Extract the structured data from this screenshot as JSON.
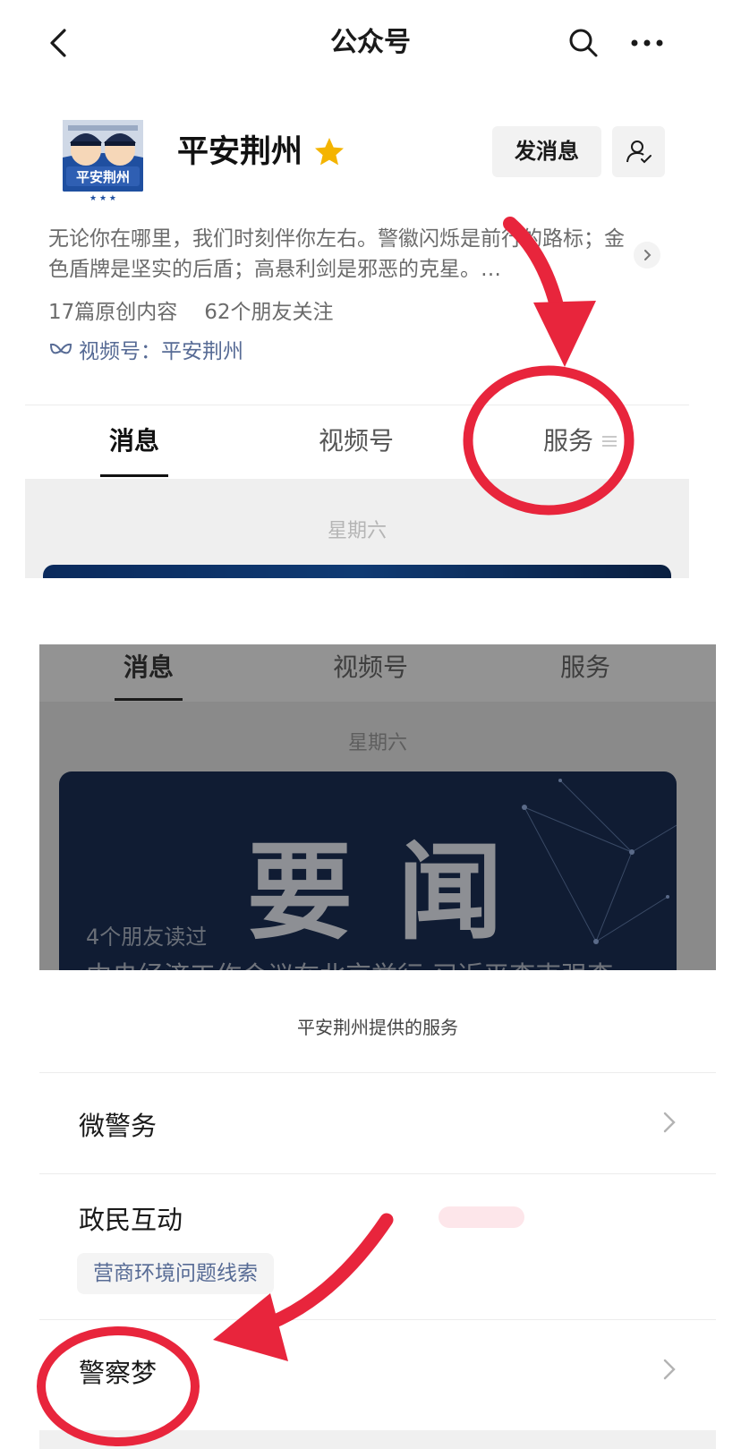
{
  "header": {
    "title": "公众号"
  },
  "account": {
    "name": "平安荆州",
    "avatar_text": "平安荆州",
    "send_message_label": "发消息",
    "description": "无论你在哪里，我们时刻伴你左右。警徽闪烁是前行的路标；金色盾牌是坚实的后盾；高悬利剑是邪恶的克星。…",
    "stats": {
      "original": "17篇原创内容",
      "friends": "62个朋友关注"
    },
    "channel": "视频号：平安荆州"
  },
  "tabs": [
    {
      "label": "消息"
    },
    {
      "label": "视频号"
    },
    {
      "label": "服务"
    }
  ],
  "feed": {
    "date": "星期六",
    "card": {
      "headline": "要闻",
      "friends_read": "4个朋友读过",
      "title": "中央经济工作会议在北京举行 习近平李克强李"
    }
  },
  "sheet": {
    "title": "平安荆州提供的服务",
    "items": [
      {
        "label": "微警务"
      },
      {
        "label": "政民互动",
        "tag": "营商环境问题线索"
      },
      {
        "label": "警察梦"
      }
    ]
  },
  "colors": {
    "link": "#576b95",
    "annotation": "#e8253c",
    "gold_star": "#f4b400"
  }
}
